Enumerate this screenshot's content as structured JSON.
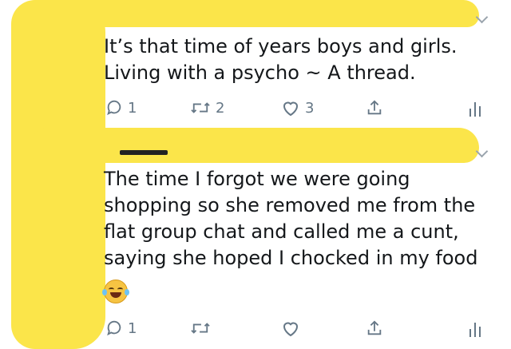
{
  "tweets": [
    {
      "text": "It’s that time of years boys and girls.\nLiving with a psycho ~ A thread.",
      "reply_count": "1",
      "retweet_count": "2",
      "like_count": "3"
    },
    {
      "text": "The time I forgot we were going\nshopping so she removed me from the\nflat group chat and called me a cunt,\nsaying she hoped I chocked in my food",
      "emoji": "crying-laughing-emoji",
      "reply_count": "1",
      "retweet_count": "",
      "like_count": ""
    }
  ],
  "colors": {
    "highlight": "#fbe54a",
    "icon": "#657786",
    "text": "#14171a"
  }
}
